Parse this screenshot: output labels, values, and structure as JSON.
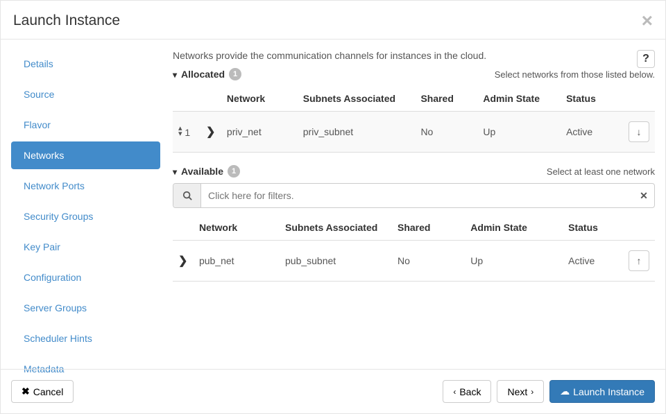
{
  "modal": {
    "title": "Launch Instance",
    "close_label": "×"
  },
  "sidebar": {
    "items": [
      {
        "label": "Details",
        "active": false
      },
      {
        "label": "Source",
        "active": false
      },
      {
        "label": "Flavor",
        "active": false
      },
      {
        "label": "Networks",
        "active": true
      },
      {
        "label": "Network Ports",
        "active": false
      },
      {
        "label": "Security Groups",
        "active": false
      },
      {
        "label": "Key Pair",
        "active": false
      },
      {
        "label": "Configuration",
        "active": false
      },
      {
        "label": "Server Groups",
        "active": false
      },
      {
        "label": "Scheduler Hints",
        "active": false
      },
      {
        "label": "Metadata",
        "active": false
      }
    ]
  },
  "content": {
    "description": "Networks provide the communication channels for instances in the cloud.",
    "help_label": "?",
    "allocated": {
      "title": "Allocated",
      "count": "1",
      "hint": "Select networks from those listed below.",
      "columns": {
        "network": "Network",
        "subnets": "Subnets Associated",
        "shared": "Shared",
        "admin_state": "Admin State",
        "status": "Status"
      },
      "rows": [
        {
          "order": "1",
          "network": "priv_net",
          "subnets": "priv_subnet",
          "shared": "No",
          "admin_state": "Up",
          "status": "Active"
        }
      ]
    },
    "available": {
      "title": "Available",
      "count": "1",
      "hint": "Select at least one network",
      "filter_placeholder": "Click here for filters.",
      "columns": {
        "network": "Network",
        "subnets": "Subnets Associated",
        "shared": "Shared",
        "admin_state": "Admin State",
        "status": "Status"
      },
      "rows": [
        {
          "network": "pub_net",
          "subnets": "pub_subnet",
          "shared": "No",
          "admin_state": "Up",
          "status": "Active"
        }
      ]
    }
  },
  "footer": {
    "cancel": "Cancel",
    "back": "Back",
    "next": "Next",
    "launch": "Launch Instance"
  }
}
